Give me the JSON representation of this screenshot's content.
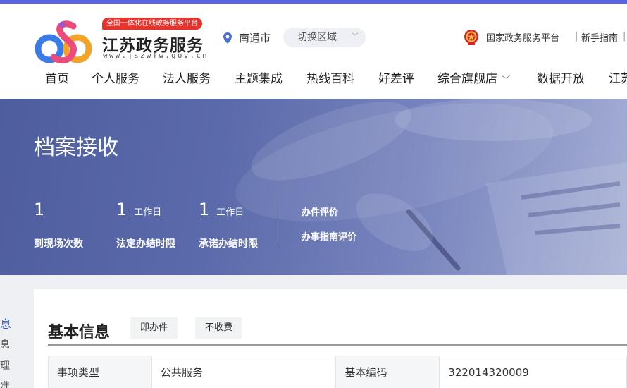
{
  "header": {
    "slogan": "全国一体化在线政务服务平台",
    "site_name": "江苏政务服务",
    "site_url": "www.jszwfw.gov.cn",
    "location": "南通市",
    "switch_region": "切换区域",
    "gov_platform": "国家政务服务平台",
    "new_user_guide": "新手指南",
    "separator": "|"
  },
  "nav": {
    "items": [
      "首页",
      "个人服务",
      "法人服务",
      "主题集成",
      "热线百科",
      "好差评",
      "综合旗舰店",
      "数据开放",
      "江苏"
    ]
  },
  "banner": {
    "title": "档案接收",
    "stats": [
      {
        "value": "1",
        "unit": "",
        "label": "到现场次数"
      },
      {
        "value": "1",
        "unit": "工作日",
        "label": "法定办结时限"
      },
      {
        "value": "1",
        "unit": "工作日",
        "label": "承诺办结时限"
      }
    ],
    "links": [
      "办件评价",
      "办事指南评价"
    ]
  },
  "sidebar": {
    "fragments": [
      "息",
      "息",
      "理",
      "准"
    ]
  },
  "content": {
    "title": "基本信息",
    "tags": [
      "即办件",
      "不收费"
    ],
    "table": [
      {
        "k1": "事项类型",
        "v1": "公共服务",
        "k2": "基本编码",
        "v2": "322014320009"
      }
    ]
  },
  "colors": {
    "accent": "#5b63e0",
    "slogan_red": "#e8332d",
    "banner": "#5b6aaa"
  }
}
